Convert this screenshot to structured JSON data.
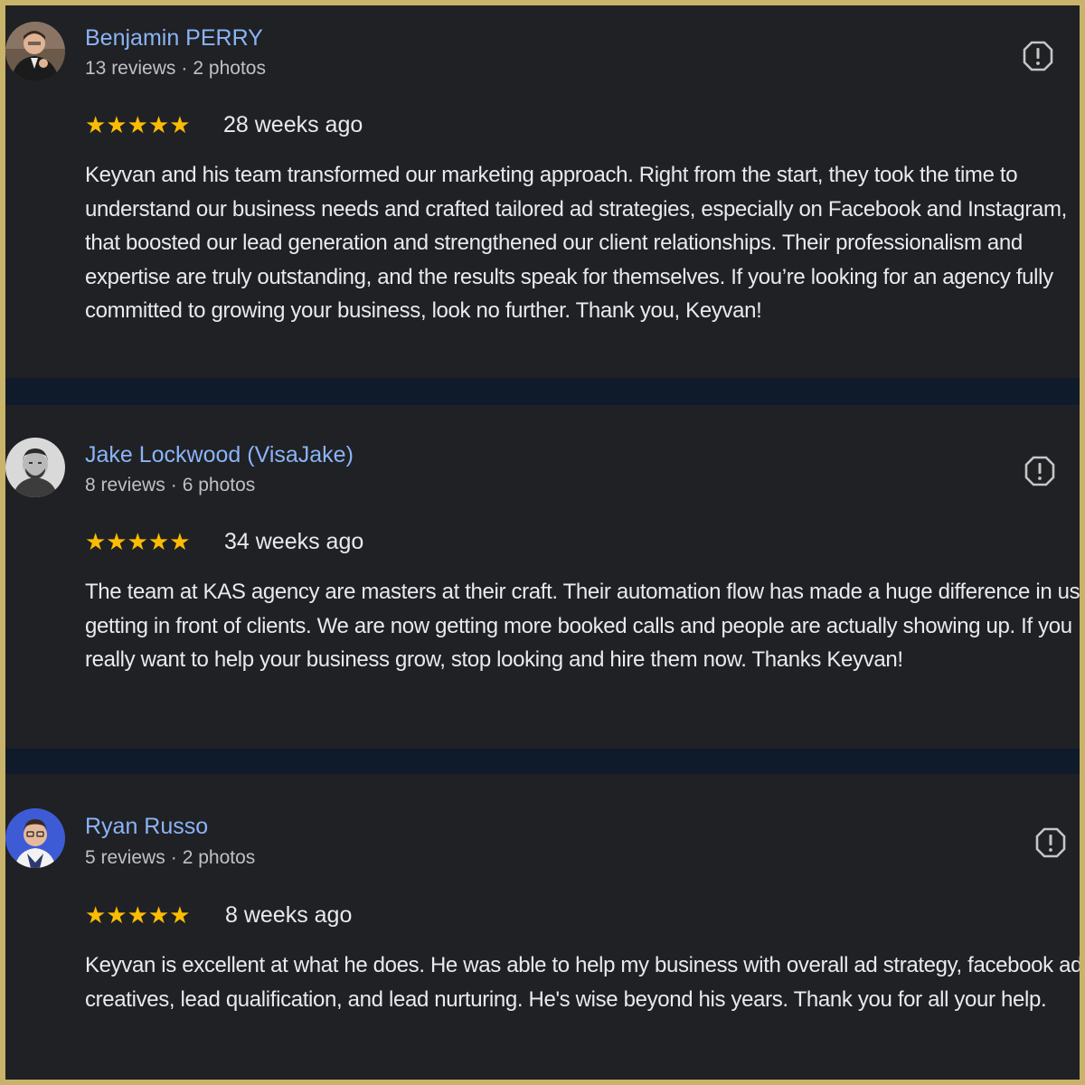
{
  "reviews": [
    {
      "name": "Benjamin PERRY",
      "reviews_count": "13 reviews",
      "photos_count": "2 photos",
      "separator": "·",
      "stars": "★★★★★",
      "rating": 5,
      "time": "28 weeks ago",
      "text": "Keyvan and his team transformed our marketing approach. Right from the start, they took the time to understand our business needs and crafted tailored ad strategies, especially on Facebook and Instagram, that boosted our lead generation and strengthened our client relationships. Their professionalism and expertise are truly outstanding, and the results speak for themselves. If you’re looking for an agency fully committed to growing your business, look no further. Thank you, Keyvan!",
      "avatar_icon": "person-photo-icon",
      "flag_icon": "report-flag-icon"
    },
    {
      "name": "Jake Lockwood (VisaJake)",
      "reviews_count": "8 reviews",
      "photos_count": "6 photos",
      "separator": "·",
      "stars": "★★★★★",
      "rating": 5,
      "time": "34 weeks ago",
      "text": "The team at KAS agency are masters at their craft. Their automation flow has made a huge difference in us getting in front of clients. We are now getting more booked calls and people are actually showing up. If you really want to help your business grow, stop looking and hire them now. Thanks Keyvan!",
      "avatar_icon": "person-photo-icon",
      "flag_icon": "report-flag-icon"
    },
    {
      "name": "Ryan Russo",
      "reviews_count": "5 reviews",
      "photos_count": "2 photos",
      "separator": "·",
      "stars": "★★★★★",
      "rating": 5,
      "time": "8 weeks ago",
      "text": "Keyvan is excellent at what he does. He was able to help my business with overall ad strategy, facebook ad creatives, lead qualification, and lead nurturing. He's wise beyond his years. Thank you for all your help.",
      "avatar_icon": "person-photo-icon",
      "flag_icon": "report-flag-icon"
    }
  ],
  "colors": {
    "frame": "#c9b26a",
    "gap": "#0f1a2a",
    "card": "#202124",
    "name": "#8ab4f8",
    "meta": "#bdc1c6",
    "text": "#e8eaed",
    "star": "#fbbc04"
  }
}
